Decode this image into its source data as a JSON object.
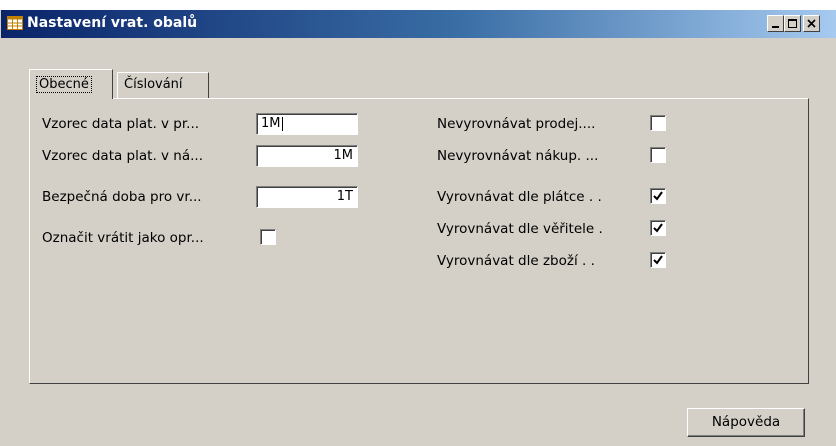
{
  "window": {
    "title": "Nastavení vrat. obalů",
    "icon": "form-grid-icon"
  },
  "titlebar_buttons": {
    "minimize": "minimize-icon",
    "maximize": "maximize-icon",
    "close": "close-icon"
  },
  "tabs": [
    {
      "label": "Obecné",
      "active": true
    },
    {
      "label": "Číslování",
      "active": false
    }
  ],
  "left_fields": [
    {
      "label": "Vzorec data plat. v pr...",
      "value": "1M"
    },
    {
      "label": "Vzorec data plat. v ná...",
      "value": "1M"
    },
    {
      "label": "Bezpečná doba pro vr...",
      "value": "1T"
    }
  ],
  "left_checkbox": {
    "label": "Označit vrátit jako opr...",
    "checked": false
  },
  "right_checkboxes": [
    {
      "label": "Nevyrovnávat prodej....",
      "checked": false
    },
    {
      "label": "Nevyrovnávat nákup. ...",
      "checked": false
    },
    {
      "label": "Vyrovnávat dle plátce . .",
      "checked": true
    },
    {
      "label": "Vyrovnávat dle věřitele .",
      "checked": true
    },
    {
      "label": "Vyrovnávat dle zboží  . .",
      "checked": true
    }
  ],
  "help_button": "Nápověda",
  "colors": {
    "title_start": "#0a246a",
    "title_end": "#a6caf0",
    "face": "#d4d0c8"
  }
}
